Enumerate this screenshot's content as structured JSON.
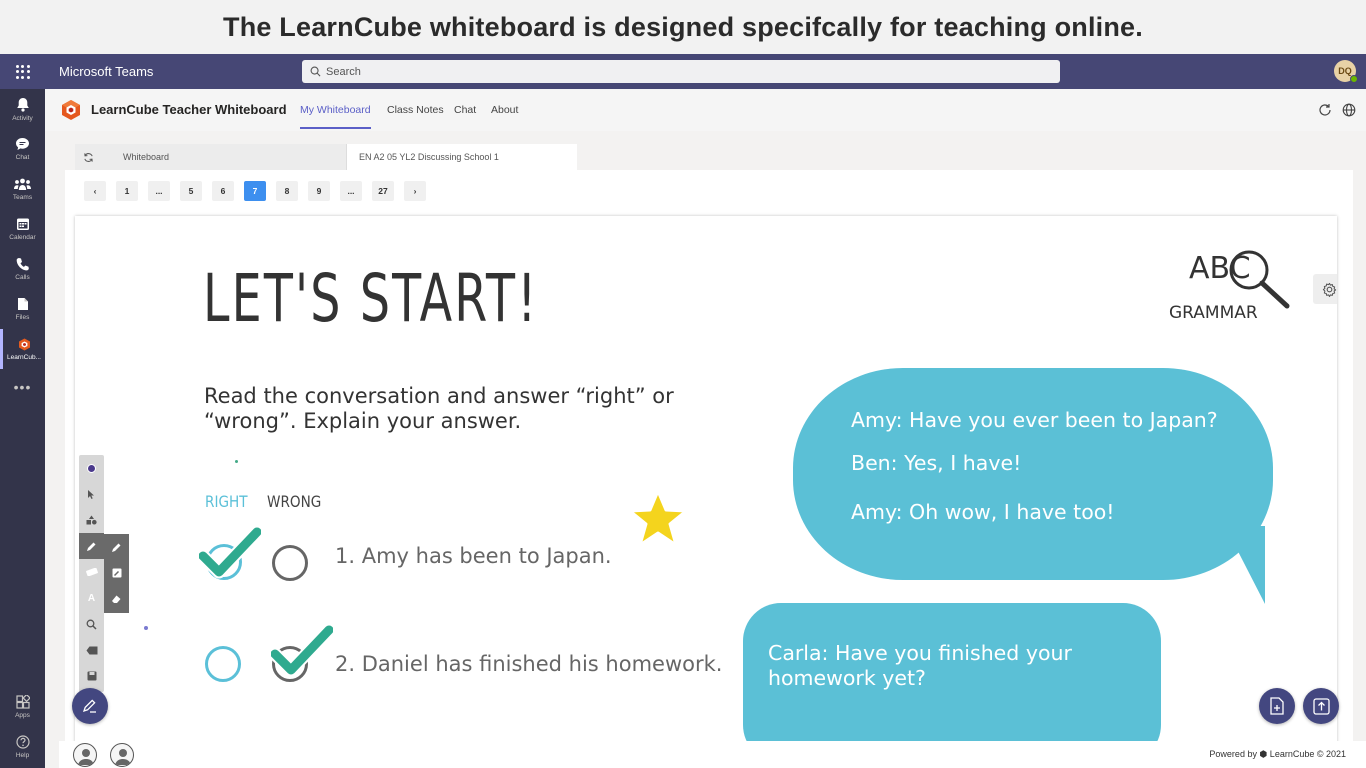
{
  "banner": {
    "text": "The LearnCube whiteboard is designed specifcally for teaching online."
  },
  "teams": {
    "app_name": "Microsoft Teams",
    "search_placeholder": "Search",
    "user_initials": "DQ",
    "rail": [
      {
        "label": "Activity",
        "icon": "bell-icon"
      },
      {
        "label": "Chat",
        "icon": "chat-icon"
      },
      {
        "label": "Teams",
        "icon": "teams-icon"
      },
      {
        "label": "Calendar",
        "icon": "calendar-icon"
      },
      {
        "label": "Calls",
        "icon": "phone-icon"
      },
      {
        "label": "Files",
        "icon": "file-icon"
      },
      {
        "label": "LearnCub...",
        "icon": "learncube-icon"
      }
    ],
    "rail_more": "•••",
    "rail_bottom": [
      {
        "label": "Apps",
        "icon": "apps-icon"
      },
      {
        "label": "Help",
        "icon": "help-icon"
      }
    ]
  },
  "appbar": {
    "title": "LearnCube Teacher Whiteboard",
    "tabs": [
      "My Whiteboard",
      "Class Notes",
      "Chat",
      "About"
    ],
    "active_tab": "My Whiteboard"
  },
  "doc_tabs": {
    "whiteboard": "Whiteboard",
    "lesson": "EN A2 05 YL2 Discussing School 1"
  },
  "pager": {
    "prev": "‹",
    "pages": [
      "1",
      "...",
      "5",
      "6",
      "7",
      "8",
      "9",
      "...",
      "27"
    ],
    "current": "7",
    "next": "›"
  },
  "slide": {
    "heading": "LET'S START!",
    "instructions": "Read the conversation and answer “right” or “wrong”. Explain your answer.",
    "right_label": "RIGHT",
    "wrong_label": "WRONG",
    "questions": [
      {
        "text": "1. Amy has been to Japan.",
        "answer": "right"
      },
      {
        "text": "2. Daniel has finished his homework.",
        "answer": "wrong"
      }
    ],
    "grammar_logo_letters": "ABC",
    "grammar_logo_word": "GRAMMAR",
    "bubble1": [
      "Amy: Have you ever been to Japan?",
      "Ben: Yes, I have!",
      "Amy: Oh wow, I have too!"
    ],
    "bubble2": [
      "Carla: Have you finished your",
      "homework yet?"
    ]
  },
  "colors": {
    "teams_purple": "#464775",
    "rail": "#33344a",
    "accent": "#5b5fc7",
    "bubble": "#5bc0d6",
    "check": "#2faa8f",
    "star": "#f4d41d",
    "page_active": "#3d8fef"
  },
  "footer": {
    "powered": "Powered by ⬢ LearnCube © 2021"
  }
}
